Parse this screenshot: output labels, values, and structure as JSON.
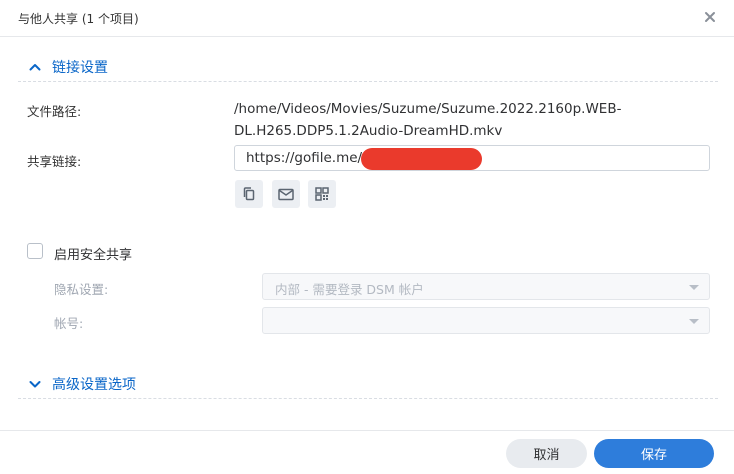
{
  "window": {
    "title": "与他人共享 (1 个项目)",
    "close_icon": "close-icon"
  },
  "link_section": {
    "title": "链接设置",
    "expanded": true
  },
  "file_path": {
    "label": "文件路径:",
    "line1": "/home/Videos/Movies/Suzume/Suzume.2022.2160p.WEB-",
    "line2": "DL.H265.DDP5.1.2Audio-DreamHD.mkv"
  },
  "share_link": {
    "label": "共享链接:",
    "value": "https://gofile.me/",
    "actions": [
      "copy-icon",
      "email-icon",
      "qr-code-icon"
    ]
  },
  "secure_share": {
    "label": "启用安全共享",
    "checked": false,
    "privacy_label": "隐私设置:",
    "privacy_value": "内部 - 需要登录 DSM 帐户",
    "account_label": "帐号:",
    "account_value": ""
  },
  "advanced_section": {
    "title": "高级设置选项",
    "expanded": false
  },
  "footer": {
    "cancel": "取消",
    "save": "保存"
  },
  "colors": {
    "accent": "#2e7ddb",
    "section_title": "#0a66c8",
    "redaction": "#ea3a2c"
  }
}
